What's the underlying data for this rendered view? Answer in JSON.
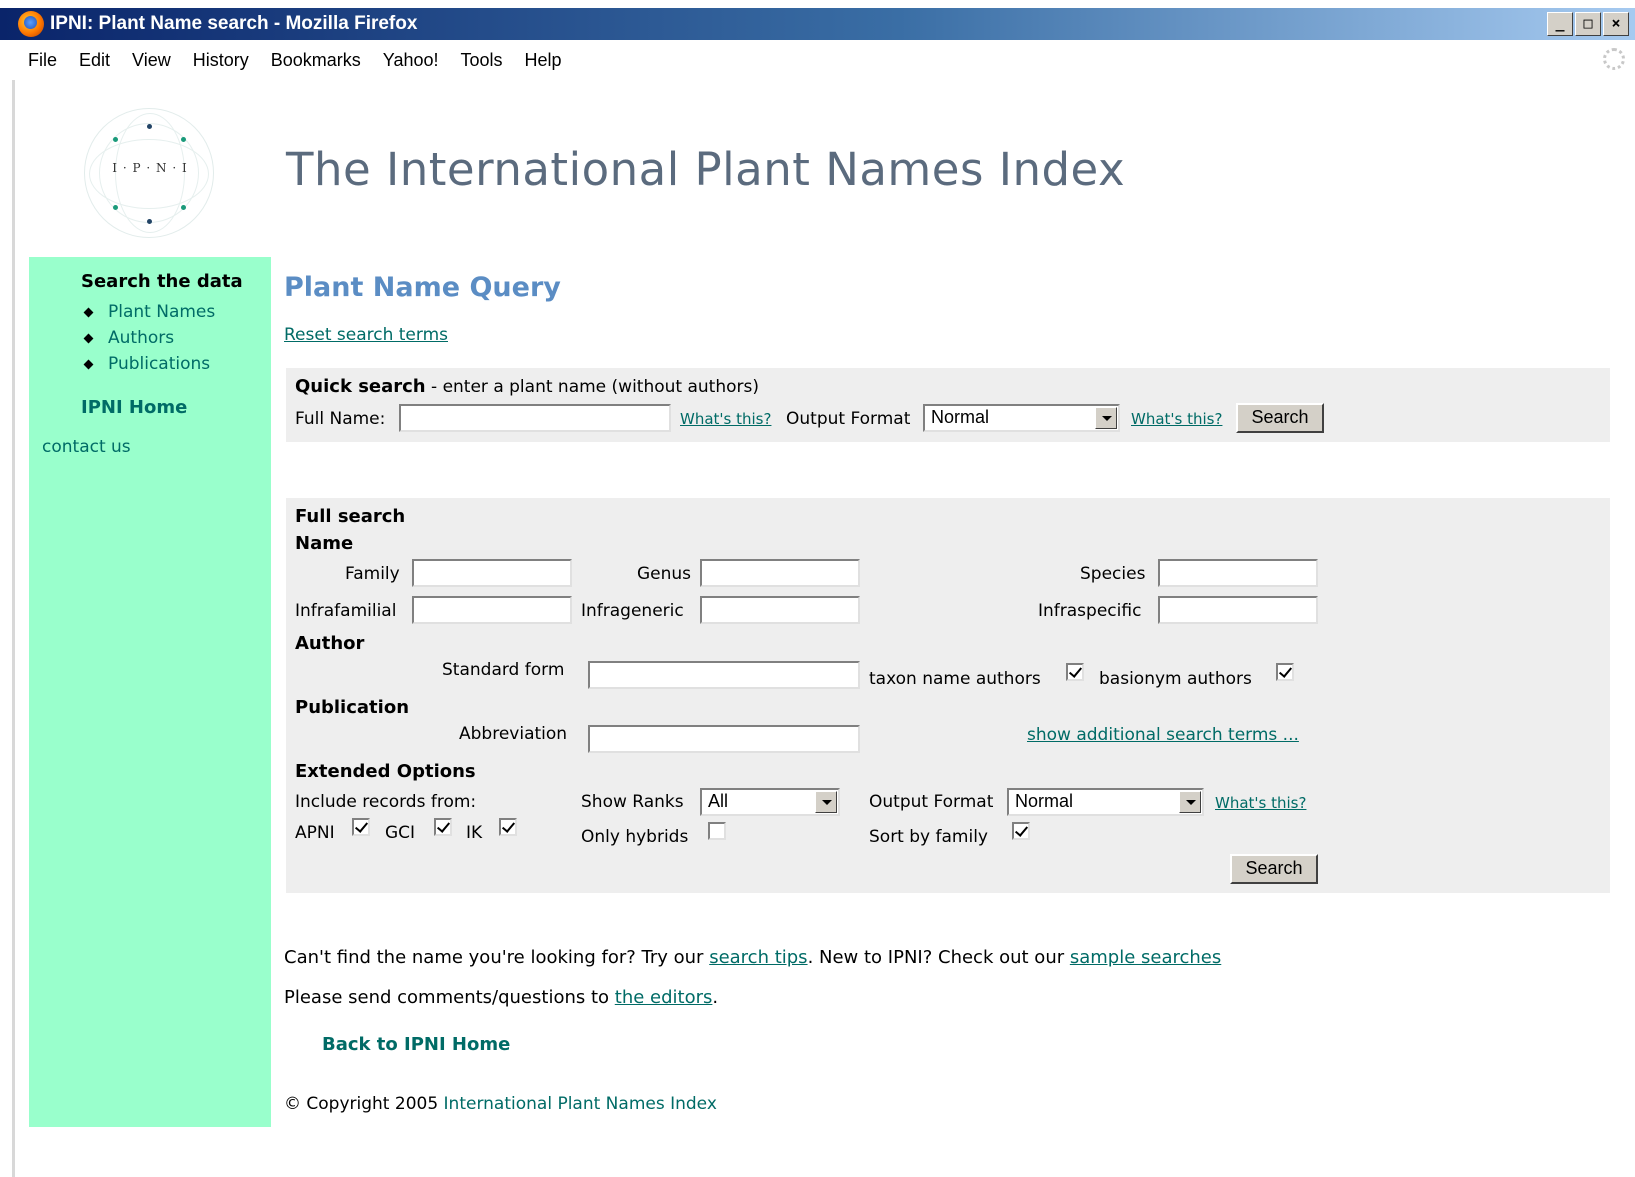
{
  "window": {
    "title": "IPNI: Plant Name search - Mozilla Firefox",
    "controls": [
      "_",
      "□",
      "×"
    ]
  },
  "menu": [
    "File",
    "Edit",
    "View",
    "History",
    "Bookmarks",
    "Yahoo!",
    "Tools",
    "Help"
  ],
  "logo": {
    "text": "I · P · N · I"
  },
  "site_title": "The International Plant Names Index",
  "sidebar": {
    "heading": "Search the data",
    "items": [
      "Plant Names",
      "Authors",
      "Publications"
    ],
    "home": "IPNI Home",
    "contact": "contact us"
  },
  "main": {
    "title": "Plant Name Query",
    "reset": "Reset search terms"
  },
  "quick": {
    "heading": "Quick search",
    "subtitle": " - enter a plant name (without authors)",
    "full_name_label": "Full Name:",
    "full_name_value": "",
    "whats_this": "What's this?",
    "output_label": "Output Format",
    "output_value": "Normal",
    "whats_this_2": "What's this?",
    "search": "Search"
  },
  "full": {
    "heading": "Full search",
    "name_heading": "Name",
    "fields": {
      "family": "Family",
      "genus": "Genus",
      "species": "Species",
      "infrafamilial": "Infrafamilial",
      "infrageneric": "Infrageneric",
      "infraspecific": "Infraspecific"
    },
    "author_heading": "Author",
    "standard_form": "Standard form",
    "taxon_authors": "taxon name authors",
    "taxon_authors_checked": true,
    "basionym_authors": "basionym authors",
    "basionym_authors_checked": true,
    "publication_heading": "Publication",
    "abbreviation": "Abbreviation",
    "show_additional": "show additional search terms ...",
    "extended_heading": "Extended Options",
    "include_from": "Include records from:",
    "apni": "APNI",
    "gci": "GCI",
    "ik": "IK",
    "apni_checked": true,
    "gci_checked": true,
    "ik_checked": true,
    "show_ranks": "Show Ranks",
    "ranks_value": "All",
    "only_hybrids": "Only hybrids",
    "only_hybrids_checked": false,
    "output_label": "Output Format",
    "output_value": "Normal",
    "whats_this": "What's this?",
    "sort_family": "Sort by family",
    "sort_family_checked": true,
    "search": "Search"
  },
  "footer": {
    "cant_find_1": "Can't find the name you're looking for? Try our ",
    "search_tips": "search tips",
    "cant_find_2": ". New to IPNI? Check out our ",
    "sample_searches": "sample searches",
    "comments_1": "Please send comments/questions to ",
    "the_editors": "the editors",
    "comments_2": ".",
    "back": "Back to IPNI Home",
    "copyright": "© Copyright 2005 ",
    "org": "International Plant Names Index"
  }
}
